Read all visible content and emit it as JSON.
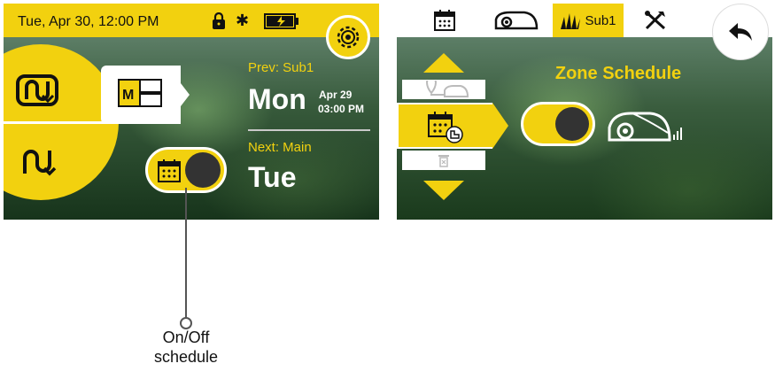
{
  "left_screen": {
    "status_bar": {
      "datetime": "Tue, Apr 30, 12:00 PM",
      "icons": [
        "lock-icon",
        "bluetooth-icon",
        "battery-charging-icon"
      ]
    },
    "settings_icon": "gear-icon",
    "mode_buttons": [
      "auto-mode-icon",
      "route-mode-icon"
    ],
    "zone_selector_label": "M",
    "schedule_toggle": {
      "state": "off",
      "icon": "calendar-icon"
    },
    "prev": {
      "label": "Prev: Sub1",
      "day": "Mon",
      "date": "Apr 29",
      "time": "03:00 PM"
    },
    "next": {
      "label": "Next: Main",
      "day": "Tue"
    }
  },
  "right_screen": {
    "tabs": [
      {
        "icon": "calendar-icon"
      },
      {
        "icon": "mower-icon"
      },
      {
        "icon": "grass-icon",
        "label": "Sub1"
      },
      {
        "icon": "tools-icon"
      }
    ],
    "back_icon": "back-arrow-icon",
    "menu_icons": [
      "up-arrow-icon",
      "location-mower-icon",
      "calendar-zone-icon",
      "trash-icon",
      "down-arrow-icon"
    ],
    "title": "Zone Schedule",
    "toggle": {
      "state": "off"
    },
    "mower_icon": "mower-signal-icon"
  },
  "callout": {
    "line1": "On/Off",
    "line2": "schedule"
  },
  "colors": {
    "accent": "#f2d10f",
    "knob": "#333333",
    "white": "#ffffff"
  }
}
